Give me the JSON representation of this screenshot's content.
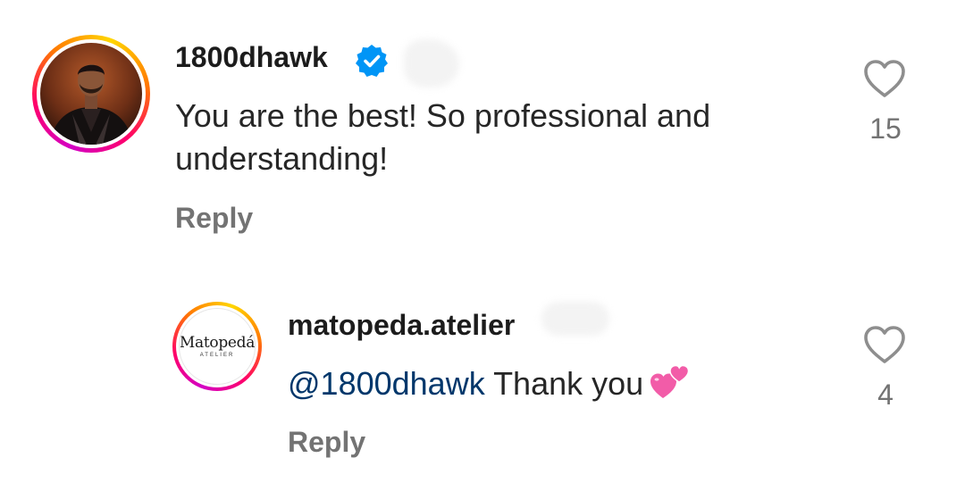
{
  "comments": [
    {
      "username": "1800dhawk",
      "verified": true,
      "text": "You are the best! So professional and understanding!",
      "reply_label": "Reply",
      "likes": "15"
    }
  ],
  "replies": [
    {
      "username": "matopeda.atelier",
      "avatar_logo_text": "Matopedá",
      "avatar_logo_subtext": "ATELIER",
      "mention": "@1800dhawk",
      "text": "Thank you",
      "emoji": "two-hearts",
      "reply_label": "Reply",
      "likes": "4"
    }
  ],
  "colors": {
    "verified_blue": "#0095f6",
    "mention_blue": "#00376b",
    "muted_gray": "#737373",
    "emoji_pink": "#f25ca8"
  },
  "icons": {
    "like": "heart-outline-icon",
    "verified": "verified-badge-icon"
  }
}
